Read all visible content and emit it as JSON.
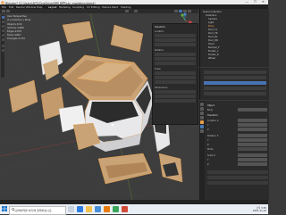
{
  "titlebar": {
    "title": "Blender* [C:\\Users\\NTS\\OneDrive\\바탕 화면\\car_modeling.blend]",
    "minimize": "—",
    "maximize": "☐",
    "close": "✕"
  },
  "menubar": {
    "items": [
      "File",
      "Edit",
      "Render",
      "Window",
      "Help",
      "Layout",
      "Modeling",
      "Sculpting",
      "UV Editing",
      "Texture Paint",
      "Shading"
    ]
  },
  "viewport": {
    "info": [
      "User Perspective",
      "(1) Collection | Body",
      "Objects 4/19",
      "Vertices 4,988",
      "Edges 9,853",
      "Faces 4,867",
      "Triangles 9,734"
    ],
    "npanel_labels": [
      "Transform",
      "Location:",
      "X",
      "Y",
      "Z",
      "Rotation:",
      "X",
      "Y",
      "Z",
      "Scale:",
      "X",
      "Y",
      "Z",
      "Dimensions:"
    ]
  },
  "outliner": {
    "items": [
      "Scene Collection",
      "Collection",
      "Camera",
      "Light",
      "Body",
      "Door_FL",
      "Door_FR",
      "Door_RL",
      "Door_RR",
      "Hood",
      "Bumper_F",
      "Fender_L",
      "Fender_R",
      "Wheel"
    ]
  },
  "properties": {
    "rows": [
      "Object",
      "Body",
      "Transform",
      "Location X",
      "Y",
      "Z",
      "Rotation X",
      "Y",
      "Z",
      "Mode",
      "Scale X",
      "Y",
      "Z"
    ]
  },
  "taskbar": {
    "search_placeholder": "검색하려면 여기에 입력하십시오.",
    "time": "오후 3:55",
    "date": "2021-11-22"
  },
  "colors": {
    "car_body": "#c9a275",
    "car_white": "#e8e8ea",
    "accent": "#e87d0d"
  }
}
